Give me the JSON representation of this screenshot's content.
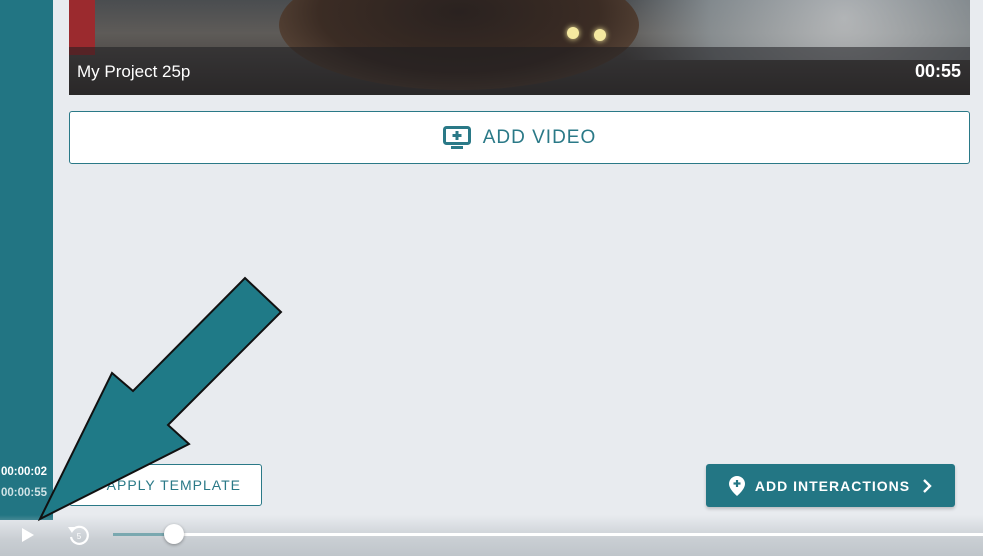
{
  "sidebar": {
    "time_current": "00:00:02",
    "time_total": "00:00:55"
  },
  "video_card": {
    "title": "My Project 25p",
    "duration": "00:55"
  },
  "main": {
    "add_video_label": "ADD VIDEO"
  },
  "footer": {
    "apply_template_label": "APPLY TEMPLATE",
    "add_interactions_label": "ADD INTERACTIONS"
  },
  "player": {
    "progress": 0.07
  },
  "colors": {
    "teal": "#227583",
    "accent": "#2a7987",
    "background": "#e8ebef"
  },
  "icons": [
    "play-icon",
    "replay-icon",
    "add-video-icon",
    "map-pin-plus-icon",
    "chevron-right-icon",
    "pointer-arrow"
  ]
}
